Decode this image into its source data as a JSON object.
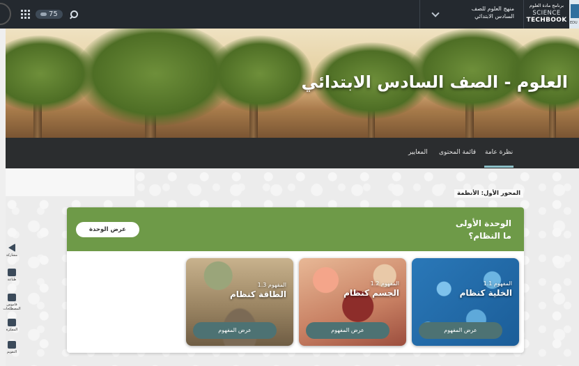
{
  "topbar": {
    "notifications_count": "75",
    "curriculum_line1": "منهج العلوم للصف",
    "curriculum_line2": "السادس الابتدائي",
    "brand_arabic": "برنامج مادة العلوم",
    "brand_science": "SCIENCE",
    "brand_techbook": "TECHBOOK",
    "brand_edu": "EDU"
  },
  "hero": {
    "title": "العلوم - الصف السادس الابتدائي"
  },
  "nav": {
    "items": [
      "نظرة عامة",
      "قائمة المحتوى",
      "المعايير"
    ],
    "active": "نظرة عامة"
  },
  "section_label": "المحور الأول: الأنظمة",
  "unit": {
    "title_line1": "الوحدة الأولى",
    "title_line2": "ما النظام؟",
    "view_button": "عرض الوحدة",
    "concepts": [
      {
        "number": "المفهوم 1.1",
        "name": "الخلية كنظام",
        "button": "عرض المفهوم"
      },
      {
        "number": "المفهوم 1.2",
        "name": "الجسم كنظام",
        "button": "عرض المفهوم"
      },
      {
        "number": "المفهوم 1.3",
        "name": "الطاقة كنظام",
        "button": "عرض المفهوم"
      }
    ]
  },
  "tools": [
    "مشاركة",
    "طباعة",
    "قاموس المصطلحات",
    "المفكرة",
    "التقويم"
  ],
  "colors": {
    "topbar": "#24292f",
    "unit_green": "#6e9a48",
    "concept_button": "#4d7273",
    "nav_bar": "#2b2d2f"
  }
}
